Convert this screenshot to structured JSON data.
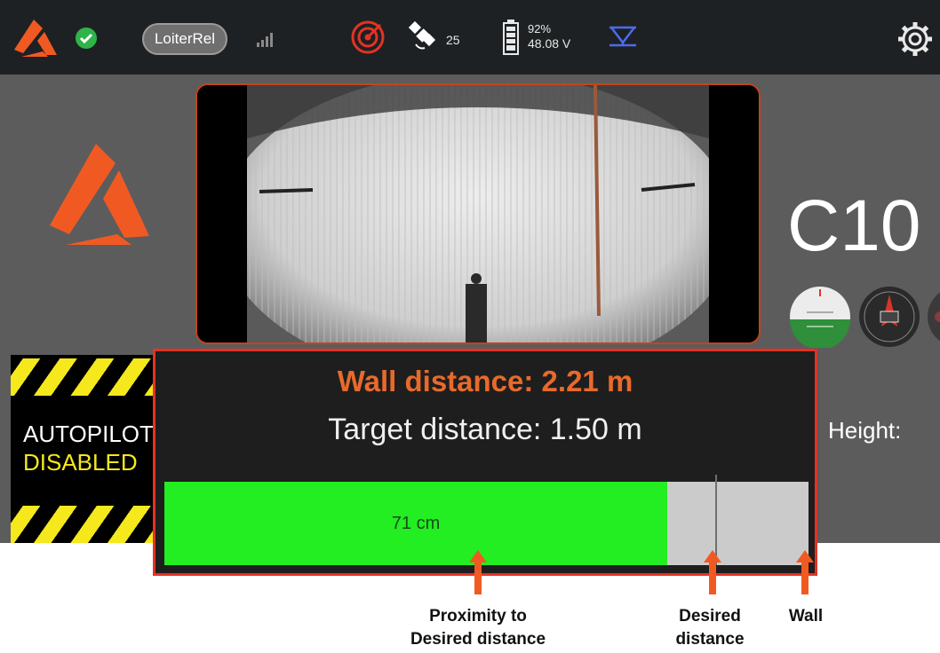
{
  "topbar": {
    "flight_mode": "LoiterRel",
    "satellite_count": "25",
    "battery_percent": "92%",
    "battery_voltage": "48.08 V"
  },
  "camera": {
    "label": "C10"
  },
  "autopilot": {
    "line1": "AUTOPILOT",
    "line2": "DISABLED"
  },
  "telemetry": {
    "height_label": "Height:"
  },
  "proximity": {
    "wall_distance": "Wall distance: 2.21 m",
    "target_distance": "Target distance: 1.50 m",
    "proximity_value": "71 cm",
    "fill_fraction": 0.78,
    "desired_marker_fraction": 0.855
  },
  "annotations": {
    "proximity_line1": "Proximity to",
    "proximity_line2": "Desired distance",
    "desired_line1": "Desired",
    "desired_line2": "distance",
    "wall": "Wall"
  },
  "colors": {
    "accent_orange": "#f05a22",
    "alert_red": "#e53223",
    "proximity_green": "#22ee22",
    "hazard_yellow": "#f5e81c"
  }
}
